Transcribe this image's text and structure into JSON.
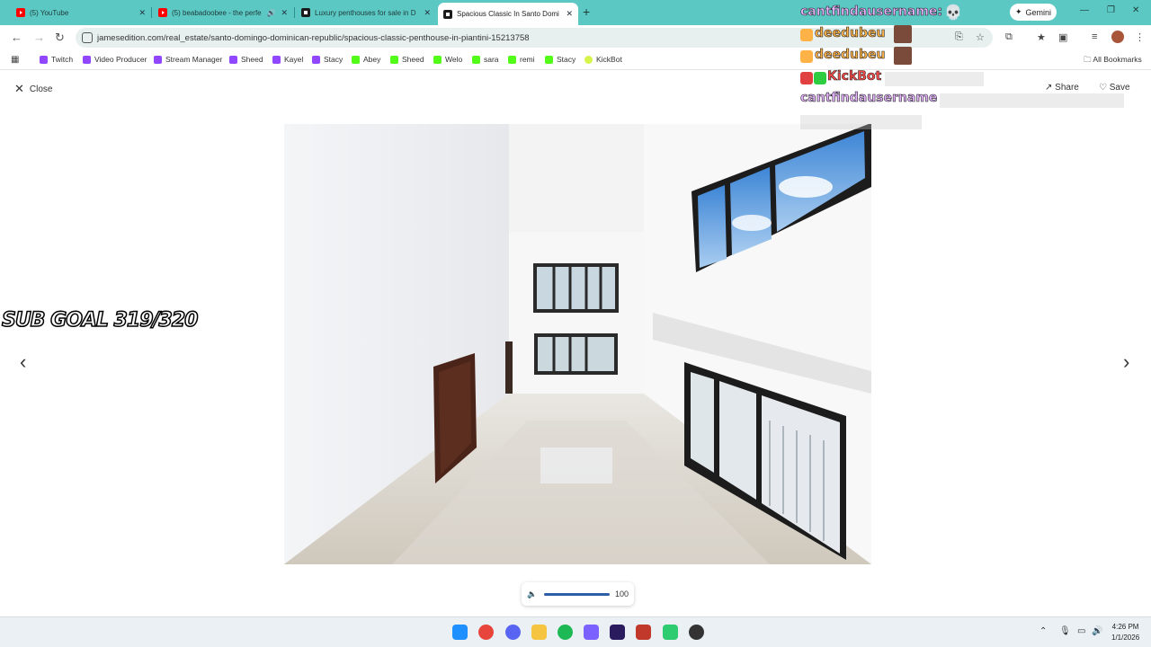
{
  "browser": {
    "tabs": [
      {
        "label": "(5) YouTube",
        "icon": "youtube-icon"
      },
      {
        "label": "(5) beabadoobee - the perfe",
        "icon": "youtube-icon"
      },
      {
        "label": "Luxury penthouses for sale in D",
        "icon": "jamesedition-icon"
      },
      {
        "label": "Spacious Classic In Santo Domi",
        "icon": "jamesedition-icon"
      }
    ],
    "gemini_label": "Gemini",
    "url": "jamesedition.com/real_estate/santo-domingo-dominican-republic/spacious-classic-penthouse-in-piantini-15213758",
    "accent": "#5bc8c3"
  },
  "bookmarks": {
    "items": [
      {
        "label": "Twitch",
        "icon": "twitch-icon"
      },
      {
        "label": "Video Producer",
        "icon": "twitch-icon"
      },
      {
        "label": "Stream Manager",
        "icon": "twitch-icon"
      },
      {
        "label": "Sheed",
        "icon": "twitch-icon"
      },
      {
        "label": "Kayel",
        "icon": "twitch-icon"
      },
      {
        "label": "Stacy",
        "icon": "twitch-icon"
      },
      {
        "label": "Abey",
        "icon": "kick-icon"
      },
      {
        "label": "Sheed",
        "icon": "kick-icon"
      },
      {
        "label": "Welo",
        "icon": "kick-icon"
      },
      {
        "label": "sara",
        "icon": "kick-icon"
      },
      {
        "label": "remi",
        "icon": "kick-icon"
      },
      {
        "label": "Stacy",
        "icon": "kick-icon"
      },
      {
        "label": "KickBot",
        "icon": "kickbot-icon"
      }
    ],
    "all_label": "All Bookmarks"
  },
  "gallery": {
    "close_label": "Close",
    "share_label": "Share",
    "save_label": "Save"
  },
  "volume": {
    "level": 100,
    "level_text": "100"
  },
  "overlay": {
    "sub_goal": "SUB GOAL 319/320",
    "chat": [
      {
        "user": "cantfindausername:",
        "color": "#e6b3ff"
      },
      {
        "user": "deedubeu",
        "color": "#ffb347"
      },
      {
        "user": "deedubeu",
        "color": "#ffb347"
      },
      {
        "user": "KickBot",
        "color": "#ff4a4a"
      },
      {
        "user": "cantfindausername",
        "color": "#e6b3ff"
      }
    ]
  },
  "taskbar": {
    "time": "4:26 PM",
    "date": "1/1/2026"
  }
}
